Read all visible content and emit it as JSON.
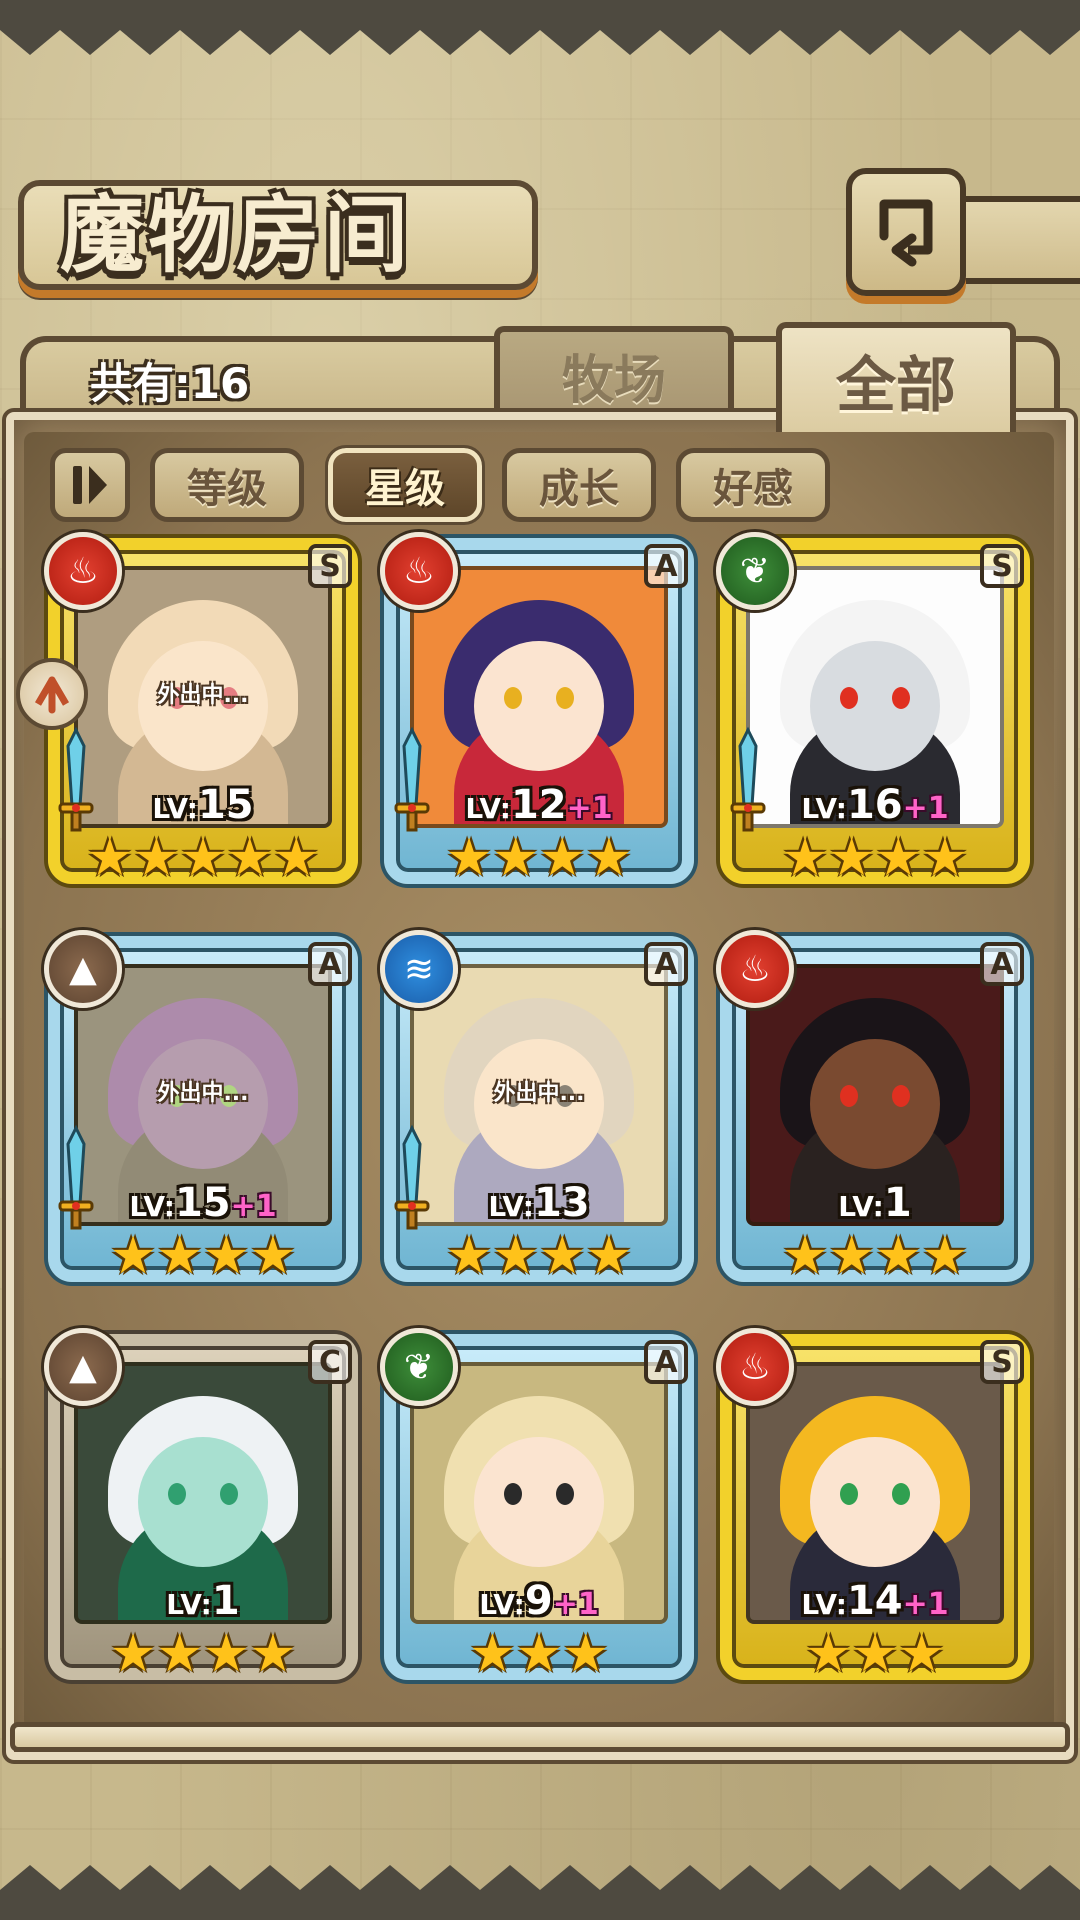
{
  "header": {
    "title": "魔物房间",
    "back_icon": "return-arrow-icon"
  },
  "count": {
    "label": "共有:16"
  },
  "tabs": [
    {
      "label": "牧场",
      "active": false
    },
    {
      "label": "全部",
      "active": true
    }
  ],
  "sort": {
    "toggle_icon": "sort-order-icon",
    "buttons": [
      {
        "label": "等级",
        "active": false
      },
      {
        "label": "星级",
        "active": true
      },
      {
        "label": "成长",
        "active": false
      },
      {
        "label": "好感",
        "active": false
      }
    ]
  },
  "out_label": "外出中...",
  "lv_prefix": "LV:",
  "monsters": [
    {
      "element": "fire",
      "rank": "S",
      "frame": "gold",
      "level": "15",
      "bonus": "",
      "stars": 5,
      "away": true,
      "sword": true,
      "colors": {
        "hair": "#e8c8a0",
        "skin": "#f6dcc4",
        "body": "#b08a60",
        "bg": "#6e5a3c",
        "eye": "#d02040"
      }
    },
    {
      "element": "fire",
      "rank": "A",
      "frame": "blue",
      "level": "12",
      "bonus": "+1",
      "stars": 4,
      "away": false,
      "sword": true,
      "colors": {
        "hair": "#3a2c6e",
        "skin": "#fbe4d0",
        "body": "#c8283a",
        "bg": "#f08a3a",
        "eye": "#e8b020"
      }
    },
    {
      "element": "wood",
      "rank": "S",
      "frame": "gold",
      "level": "16",
      "bonus": "+1",
      "stars": 4,
      "away": false,
      "sword": true,
      "colors": {
        "hair": "#f4f4f4",
        "skin": "#d8dce0",
        "body": "#2a2a30",
        "bg": "#fdfdfd",
        "eye": "#e03020"
      }
    },
    {
      "element": "earth",
      "rank": "A",
      "frame": "blue",
      "level": "15",
      "bonus": "+1",
      "stars": 4,
      "away": true,
      "sword": true,
      "colors": {
        "hair": "#6a3a8a",
        "skin": "#7a5a90",
        "body": "#3a3a2a",
        "bg": "#4a4a3a",
        "eye": "#70c040"
      }
    },
    {
      "element": "water",
      "rank": "A",
      "frame": "blue",
      "level": "13",
      "bonus": "",
      "stars": 4,
      "away": true,
      "sword": true,
      "colors": {
        "hair": "#c8c0b0",
        "skin": "#f6dcc4",
        "body": "#6a70b0",
        "bg": "#d8c898",
        "eye": "#2a2a2a"
      }
    },
    {
      "element": "fire",
      "rank": "A",
      "frame": "blue",
      "level": "1",
      "bonus": "",
      "stars": 4,
      "away": false,
      "sword": false,
      "colors": {
        "hair": "#1a1418",
        "skin": "#7a4a30",
        "body": "#2a2220",
        "bg": "#4a1a1a",
        "eye": "#e03020"
      }
    },
    {
      "element": "earth",
      "rank": "C",
      "frame": "bronze",
      "level": "1",
      "bonus": "",
      "stars": 4,
      "away": false,
      "sword": false,
      "colors": {
        "hair": "#eef2f4",
        "skin": "#a8e0d0",
        "body": "#1e6a4a",
        "bg": "#3a4a3a",
        "eye": "#30a070"
      }
    },
    {
      "element": "wood",
      "rank": "A",
      "frame": "blue",
      "level": "9",
      "bonus": "+1",
      "stars": 3,
      "away": false,
      "sword": false,
      "colors": {
        "hair": "#f0e0b0",
        "skin": "#fbe4d0",
        "body": "#e8d49a",
        "bg": "#c8b880",
        "eye": "#2a2a2a"
      }
    },
    {
      "element": "fire",
      "rank": "S",
      "frame": "gold",
      "level": "14",
      "bonus": "+1",
      "stars": 3,
      "away": false,
      "sword": false,
      "colors": {
        "hair": "#f4b820",
        "skin": "#fbe4d0",
        "body": "#2a2a3a",
        "bg": "#6a5a4a",
        "eye": "#30a050"
      }
    }
  ]
}
